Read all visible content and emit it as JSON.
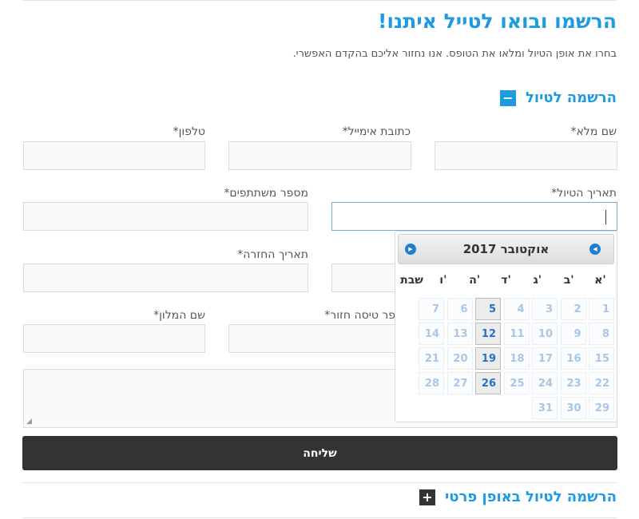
{
  "page": {
    "title": "הרשמו ובואו לטייל איתנו!",
    "subtitle": "בחרו את אופן הטיול ומלאו את הטופס. אנו נחזור אליכם בהקדם האפשרי."
  },
  "section1": {
    "toggle": "−",
    "label": "הרשמה לטיול"
  },
  "form": {
    "full_name_label": "שם מלא*",
    "email_label": "כתובת אימייל*",
    "phone_label": "טלפון*",
    "trip_date_label": "תאריך הטיול*",
    "participants_label": "מספר משתתפים*",
    "return_date_label": "תאריך החזרה*",
    "return_flight_label": "פר טיסה חזור*",
    "hotel_label": "שם המלון*",
    "submit_label": "שליחה"
  },
  "datepicker": {
    "month_title": "אוקטובר 2017",
    "days_of_week": [
      "א'",
      "ב'",
      "ג'",
      "ד'",
      "ה'",
      "ו'",
      "שבת"
    ],
    "days": [
      1,
      2,
      3,
      4,
      5,
      6,
      7,
      8,
      9,
      10,
      11,
      12,
      13,
      14,
      15,
      16,
      17,
      18,
      19,
      20,
      21,
      22,
      23,
      24,
      25,
      26,
      27,
      28,
      29,
      30,
      31
    ],
    "highlighted_days": [
      5,
      12,
      19,
      26
    ]
  },
  "section2": {
    "toggle": "+",
    "label": "הרשמה לטיול באופן פרטי"
  }
}
